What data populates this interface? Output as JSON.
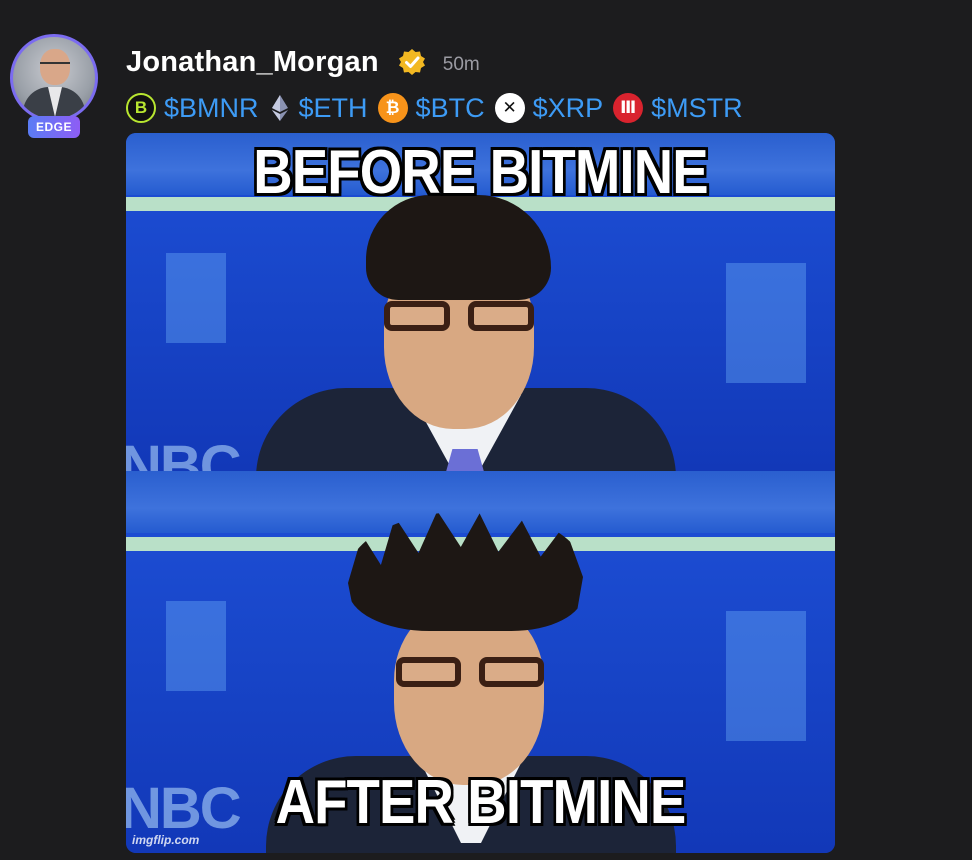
{
  "post": {
    "username": "Jonathan_Morgan",
    "timestamp": "50m",
    "badge": "EDGE",
    "verified_icon": "verified-check-icon",
    "accent_color": "#3d9bf5",
    "tickers": [
      {
        "symbol": "$BMNR",
        "icon": "bmnr-icon",
        "glyph": "B"
      },
      {
        "symbol": "$ETH",
        "icon": "ethereum-icon",
        "glyph": ""
      },
      {
        "symbol": "$BTC",
        "icon": "bitcoin-icon",
        "glyph": "₿"
      },
      {
        "symbol": "$XRP",
        "icon": "xrp-icon",
        "glyph": "✕"
      },
      {
        "symbol": "$MSTR",
        "icon": "mstr-icon",
        "glyph": "Ⅲ"
      }
    ],
    "meme": {
      "top_caption": "BEFORE BITMINE",
      "bottom_caption": "AFTER BITMINE",
      "watermark": "imgflip.com",
      "background_text": "NBC"
    }
  }
}
